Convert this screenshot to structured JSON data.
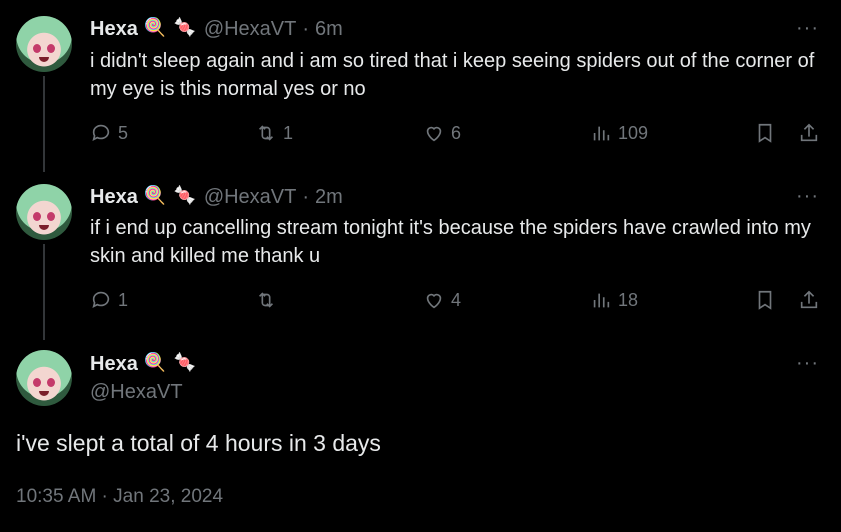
{
  "tweets": [
    {
      "name": "Hexa",
      "handle": "@HexaVT",
      "sep": "·",
      "time": "6m",
      "text": "i didn't sleep again and i am so tired that i keep seeing spiders out of the corner of my eye is this normal yes or no",
      "replies": "5",
      "retweets": "1",
      "likes": "6",
      "views": "109"
    },
    {
      "name": "Hexa",
      "handle": "@HexaVT",
      "sep": "·",
      "time": "2m",
      "text": "if i end up cancelling stream tonight it's because the spiders have crawled into my skin and killed me thank u",
      "replies": "1",
      "retweets": "",
      "likes": "4",
      "views": "18"
    }
  ],
  "main": {
    "name": "Hexa",
    "handle": "@HexaVT",
    "text": "i've slept a total of 4 hours in 3 days",
    "timestamp": "10:35 AM · Jan 23, 2024"
  },
  "more_label": "···",
  "emojis": [
    "🍭",
    "🍬"
  ]
}
